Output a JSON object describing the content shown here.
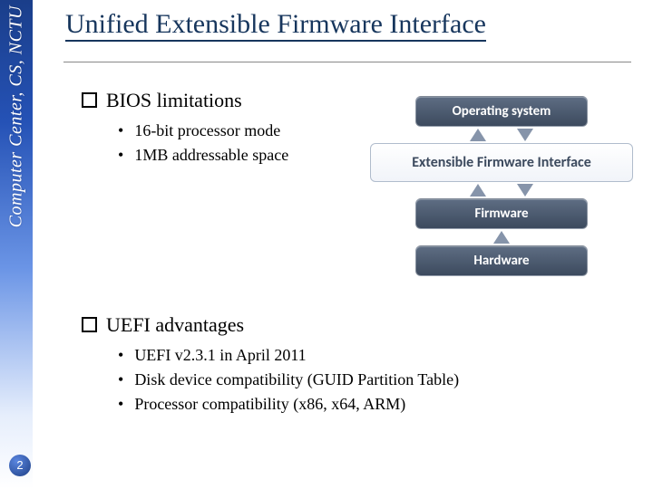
{
  "sidebar": {
    "label": "Computer Center, CS, NCTU"
  },
  "title": "Unified Extensible Firmware Interface",
  "sections": {
    "bios": {
      "heading": "BIOS limitations",
      "items": [
        "16-bit processor mode",
        "1MB addressable space"
      ]
    },
    "uefi": {
      "heading": "UEFI advantages",
      "items": [
        "UEFI v2.3.1 in April 2011",
        "Disk device compatibility (GUID Partition Table)",
        "Processor compatibility (x86, x64, ARM)"
      ]
    }
  },
  "diagram": {
    "layers": {
      "os": "Operating system",
      "efi": "Extensible Firmware Interface",
      "fw": "Firmware",
      "hw": "Hardware"
    }
  },
  "page_number": "2"
}
